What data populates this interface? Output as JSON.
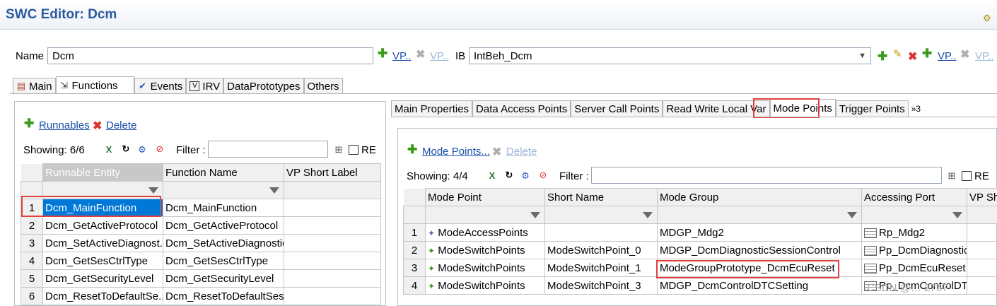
{
  "window": {
    "title": "SWC Editor: Dcm"
  },
  "name_row": {
    "name_label": "Name",
    "name_value": "Dcm",
    "vp_link": "VP..",
    "vp_link_disabled": "VP..",
    "ib_label": "IB",
    "ib_value": "IntBeh_Dcm",
    "vp_link2": "VP..",
    "vp_link2_disabled": "VP.."
  },
  "main_tabs": [
    {
      "label": "Main",
      "icon": "main-icon"
    },
    {
      "label": "Functions",
      "icon": "functions-icon",
      "selected": true
    },
    {
      "label": "Events",
      "icon": "events-icon"
    },
    {
      "label": "IRV",
      "icon": "irv-icon"
    },
    {
      "label": "DataPrototypes"
    },
    {
      "label": "Others"
    }
  ],
  "left": {
    "runnables_link": "Runnables",
    "delete_link": "Delete",
    "showing": "Showing: 6/6",
    "filter_label": "Filter :",
    "filter_value": "",
    "re_label": "RE",
    "columns": [
      "Runnable Entity",
      "Function Name",
      "VP Short Label"
    ],
    "rows": [
      {
        "n": "1",
        "entity": "Dcm_MainFunction",
        "fn": "Dcm_MainFunction",
        "vp": ""
      },
      {
        "n": "2",
        "entity": "Dcm_GetActiveProtocol",
        "fn": "Dcm_GetActiveProtocol",
        "vp": ""
      },
      {
        "n": "3",
        "entity": "Dcm_SetActiveDiagnost...",
        "fn": "Dcm_SetActiveDiagnostic",
        "vp": ""
      },
      {
        "n": "4",
        "entity": "Dcm_GetSesCtrlType",
        "fn": "Dcm_GetSesCtrlType",
        "vp": ""
      },
      {
        "n": "5",
        "entity": "Dcm_GetSecurityLevel",
        "fn": "Dcm_GetSecurityLevel",
        "vp": ""
      },
      {
        "n": "6",
        "entity": "Dcm_ResetToDefaultSe...",
        "fn": "Dcm_ResetToDefaultSes...",
        "vp": ""
      }
    ]
  },
  "right": {
    "tabs": [
      "Main Properties",
      "Data Access Points",
      "Server Call Points",
      "Read Write Local Var",
      "Mode Points",
      "Trigger Points",
      "»3"
    ],
    "selected_tab": "Mode Points",
    "mode_points_link": "Mode Points...",
    "delete_link": "Delete",
    "showing": "Showing: 4/4",
    "filter_label": "Filter :",
    "filter_value": "",
    "re_label": "RE",
    "columns": [
      "Mode Point",
      "Short Name",
      "Mode Group",
      "Accessing Port",
      "VP Sh"
    ],
    "rows": [
      {
        "n": "1",
        "point": "ModeAccessPoints",
        "short": "",
        "group": "MDGP_Mdg2",
        "port": "Rp_Mdg2",
        "kind": "access"
      },
      {
        "n": "2",
        "point": "ModeSwitchPoints",
        "short": "ModeSwitchPoint_0",
        "group": "MDGP_DcmDiagnosticSessionControl",
        "port": "Pp_DcmDiagnosticS...",
        "kind": "switch"
      },
      {
        "n": "3",
        "point": "ModeSwitchPoints",
        "short": "ModeSwitchPoint_1",
        "group": "ModeGroupPrototype_DcmEcuReset",
        "port": "Pp_DcmEcuReset",
        "kind": "switch"
      },
      {
        "n": "4",
        "point": "ModeSwitchPoints",
        "short": "ModeSwitchPoint_3",
        "group": "MDGP_DcmControlDTCSetting",
        "port": "Pp_DcmControlDTCS...",
        "kind": "switch"
      }
    ]
  },
  "watermark": "CSDN @… 2757"
}
